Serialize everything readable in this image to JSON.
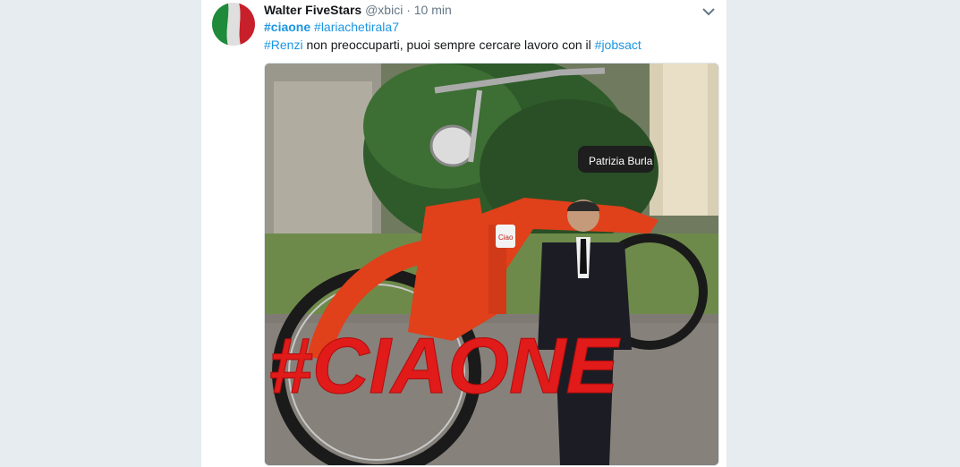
{
  "tweet": {
    "author_name": "Walter FiveStars",
    "handle": "@xbici",
    "separator": "·",
    "time": "10 min",
    "line1": {
      "tag1": "#ciaone",
      "tag2": "#lariachetirala7"
    },
    "line2": {
      "tag": "#Renzi",
      "text": " non preoccuparti, puoi sempre cercare lavoro con il ",
      "tag2": "#jobsact"
    }
  },
  "media": {
    "seat_label": "Patrizia Burla",
    "overlay_text": "#CIAONE",
    "badge_text": "Ciao"
  },
  "icons": {
    "caret": "chevron-down-icon",
    "avatar": "italian-flag-avatar"
  },
  "colors": {
    "link": "#1b95e0",
    "background": "#e6ecf0",
    "overlay": "#e11a1a",
    "moped": "#e0401a"
  }
}
